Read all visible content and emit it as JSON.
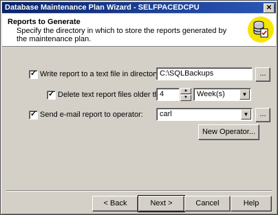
{
  "window": {
    "title": "Database Maintenance Plan Wizard - SELFPACEDCPU",
    "close_glyph": "✕"
  },
  "header": {
    "title": "Reports to Generate",
    "subtitle": "Specify the directory in which to store the reports generated by the maintenance plan.",
    "logo_icon": "database-report-icon"
  },
  "form": {
    "write_report": {
      "checked": true,
      "label": "Write report to a text file in directory:",
      "value": "C:\\SQLBackups",
      "browse_label": "..."
    },
    "delete_older": {
      "checked": true,
      "label": "Delete text report files older than:",
      "number": "4",
      "unit": "Week(s)"
    },
    "send_email": {
      "checked": true,
      "label": "Send e-mail report to operator:",
      "value": "carl",
      "browse_label": "..."
    },
    "new_operator_label": "New Operator..."
  },
  "buttons": {
    "back": "< Back",
    "next": "Next >",
    "cancel": "Cancel",
    "help": "Help"
  },
  "glyphs": {
    "check": "✓",
    "dropdown": "▼",
    "up": "▲",
    "down": "▼"
  }
}
